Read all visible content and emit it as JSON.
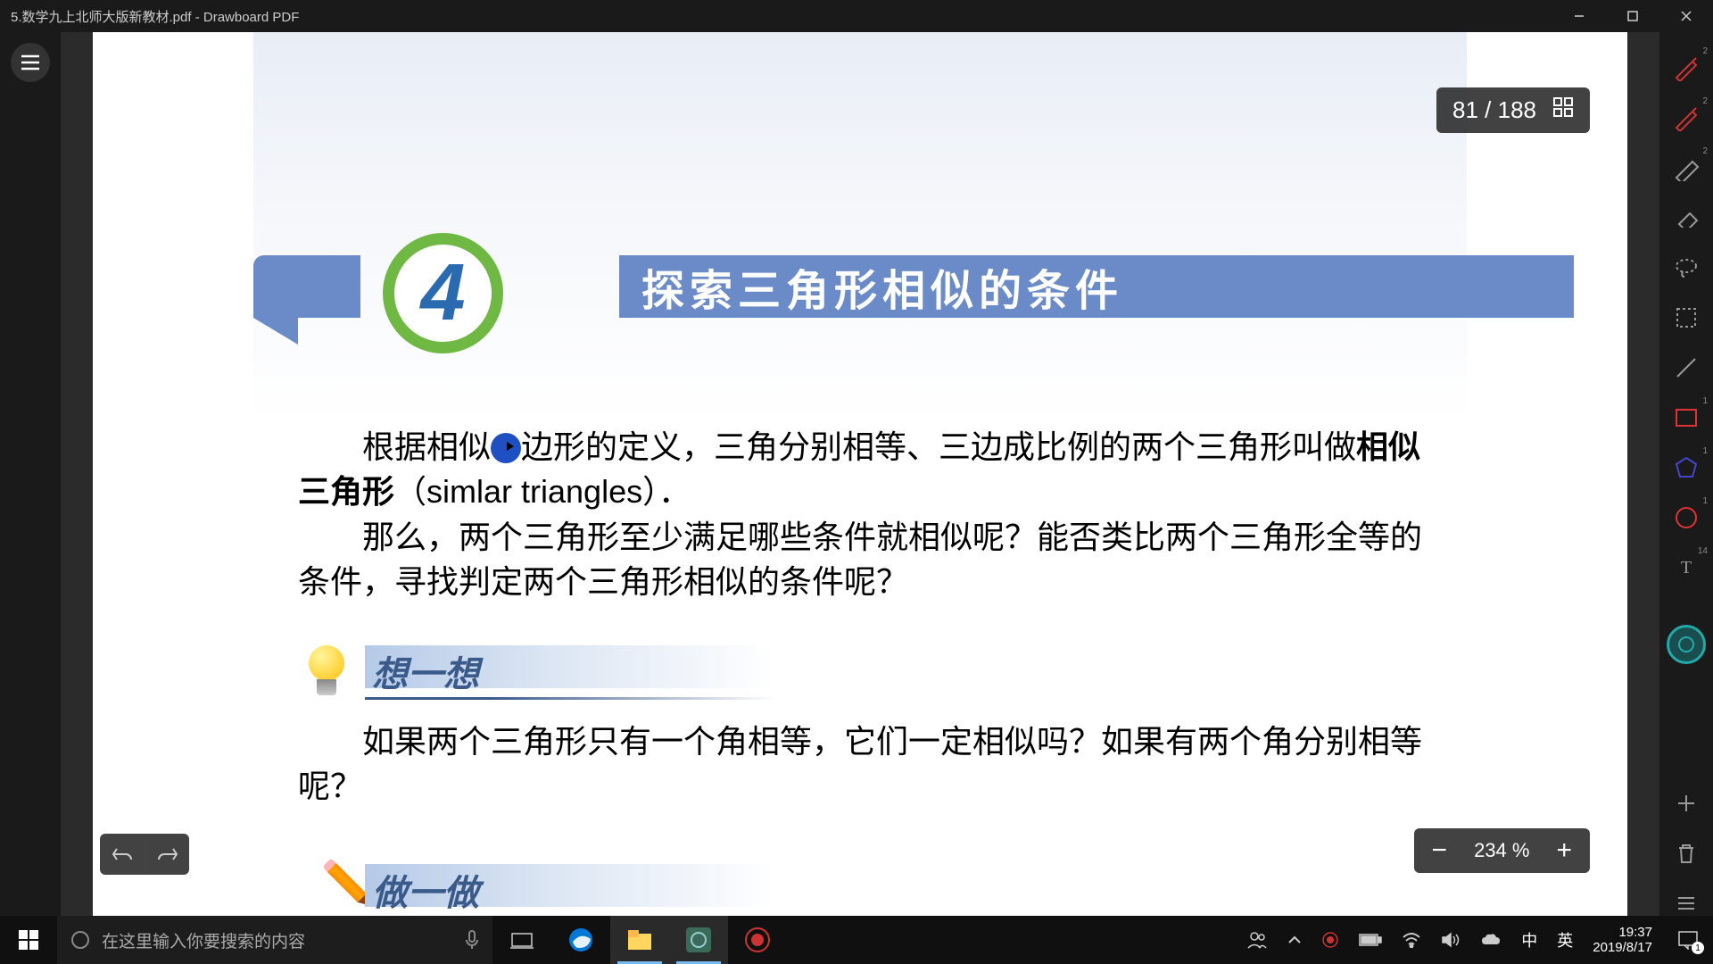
{
  "window": {
    "title": "5.数学九上北师大版新教材.pdf - Drawboard PDF"
  },
  "pageCounter": {
    "current": "81",
    "total": "188"
  },
  "zoom": {
    "value": "234 %"
  },
  "document": {
    "sectionNumber": "4",
    "sectionTitle": "探索三角形相似的条件",
    "para1_pre": "根据相似",
    "para1_post": "边形的定义，三角分别相等、三边成比例的两个三角形叫做",
    "para1_bold": "相似三角形",
    "para1_paren": "（simlar triangles）．",
    "para2": "那么，两个三角形至少满足哪些条件就相似呢？能否类比两个三角形全等的条件，寻找判定两个三角形相似的条件呢？",
    "think": {
      "title": "想一想",
      "text": "如果两个三角形只有一个角相等，它们一定相似吗？如果有两个角分别相等呢？"
    },
    "do": {
      "title": "做一做"
    }
  },
  "taskbar": {
    "searchPlaceholder": "在这里输入你要搜索的内容",
    "ime1": "中",
    "ime2": "英",
    "time": "19:37",
    "date": "2019/8/17",
    "notifCount": "1"
  },
  "tools": {
    "badges": {
      "pen1": "2",
      "pen2": "2",
      "highlighter": "2",
      "rect": "1",
      "hex": "1",
      "circle": "1",
      "text": "14"
    }
  }
}
